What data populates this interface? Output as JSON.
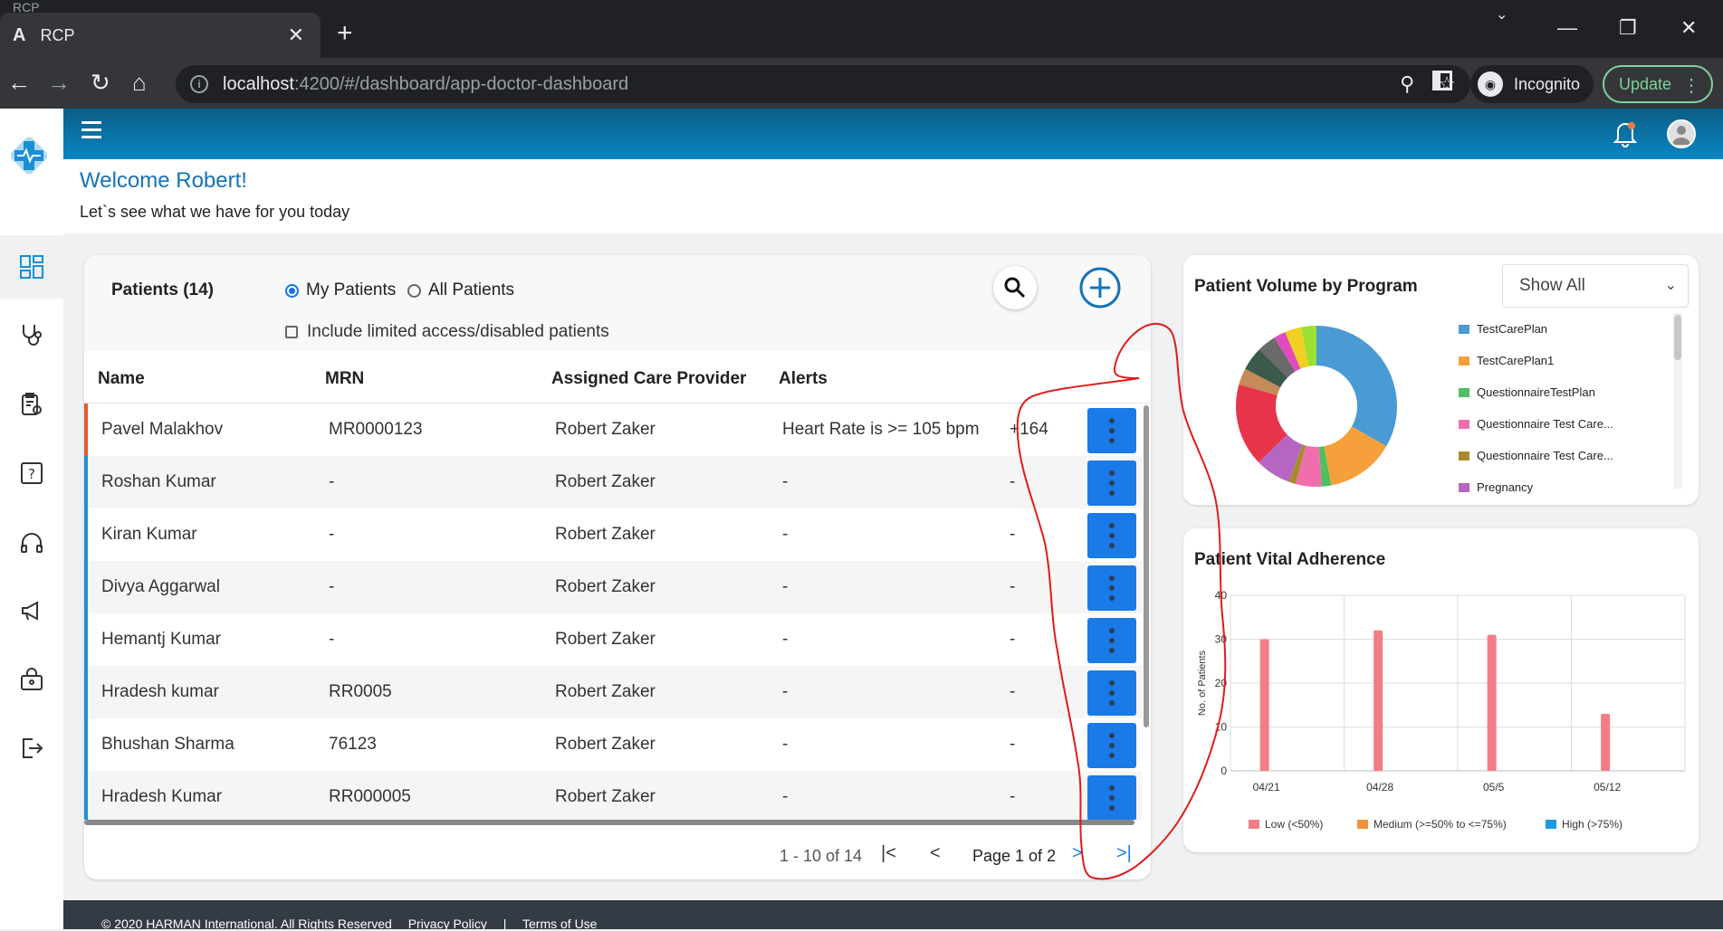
{
  "browser": {
    "tab_title": "RCP",
    "ghost_tab_title": "RCP",
    "tab_icon": "A",
    "url_host": "localhost",
    "url_path": ":4200/#/dashboard/app-doctor-dashboard",
    "incognito_label": "Incognito",
    "update_label": "Update"
  },
  "welcome": {
    "title": "Welcome Robert!",
    "subtitle": "Let`s see what we have for you today"
  },
  "patients": {
    "title": "Patients (14)",
    "radio_my": "My Patients",
    "radio_all": "All Patients",
    "checkbox_label": "Include limited access/disabled patients",
    "columns": [
      "Name",
      "MRN",
      "Assigned Care Provider",
      "Alerts"
    ],
    "rows": [
      {
        "name": "Pavel Malakhov",
        "mrn": "MR0000123",
        "provider": "Robert Zaker",
        "alert": "Heart Rate is >= 105 bpm",
        "more": "+164"
      },
      {
        "name": "Roshan Kumar",
        "mrn": "-",
        "provider": "Robert Zaker",
        "alert": "-",
        "more": "-"
      },
      {
        "name": "Kiran Kumar",
        "mrn": "-",
        "provider": "Robert Zaker",
        "alert": "-",
        "more": "-"
      },
      {
        "name": "Divya Aggarwal",
        "mrn": "-",
        "provider": "Robert Zaker",
        "alert": "-",
        "more": "-"
      },
      {
        "name": "Hemantj Kumar",
        "mrn": "-",
        "provider": "Robert Zaker",
        "alert": "-",
        "more": "-"
      },
      {
        "name": "Hradesh kumar",
        "mrn": "RR0005",
        "provider": "Robert Zaker",
        "alert": "-",
        "more": "-"
      },
      {
        "name": "Bhushan Sharma",
        "mrn": "76123",
        "provider": "Robert Zaker",
        "alert": "-",
        "more": "-"
      },
      {
        "name": "Hradesh Kumar",
        "mrn": "RR000005",
        "provider": "Robert Zaker",
        "alert": "-",
        "more": "-"
      }
    ],
    "range_label": "1 - 10 of 14",
    "page_label": "Page 1 of 2"
  },
  "volume": {
    "title": "Patient Volume by Program",
    "select_value": "Show All",
    "legend": [
      {
        "label": "TestCarePlan",
        "color": "#4a9ad4"
      },
      {
        "label": "TestCarePlan1",
        "color": "#f5a03a"
      },
      {
        "label": "QuestionnaireTestPlan",
        "color": "#4fbf5f"
      },
      {
        "label": "Questionnaire Test Care...",
        "color": "#f06eab"
      },
      {
        "label": "Questionnaire Test Care...",
        "color": "#a88a2c"
      },
      {
        "label": "Pregnancy",
        "color": "#b566c2"
      }
    ]
  },
  "chart_data": {
    "type": "bar",
    "title": "Patient Vital Adherence",
    "ylabel": "No. of Patients",
    "xlabel": "",
    "categories": [
      "04/21",
      "04/28",
      "05/5",
      "05/12"
    ],
    "ylim": [
      0,
      40
    ],
    "yticks": [
      "0",
      "10",
      "20",
      "30",
      "40"
    ],
    "series": [
      {
        "name": "Low (<50%)",
        "color": "#f47c86",
        "values": [
          30,
          32,
          31,
          13
        ]
      },
      {
        "name": "Medium (>=50% to <=75%)",
        "color": "#f0923c",
        "values": [
          0,
          0,
          0,
          0
        ]
      },
      {
        "name": "High (>75%)",
        "color": "#1a9ae0",
        "values": [
          0,
          0,
          0,
          0
        ]
      }
    ],
    "grid": true,
    "legend_position": "bottom"
  },
  "footer": {
    "copyright": "© 2020 HARMAN International. All Rights Reserved",
    "privacy": "Privacy Policy",
    "separator": "|",
    "terms": "Terms of Use"
  }
}
